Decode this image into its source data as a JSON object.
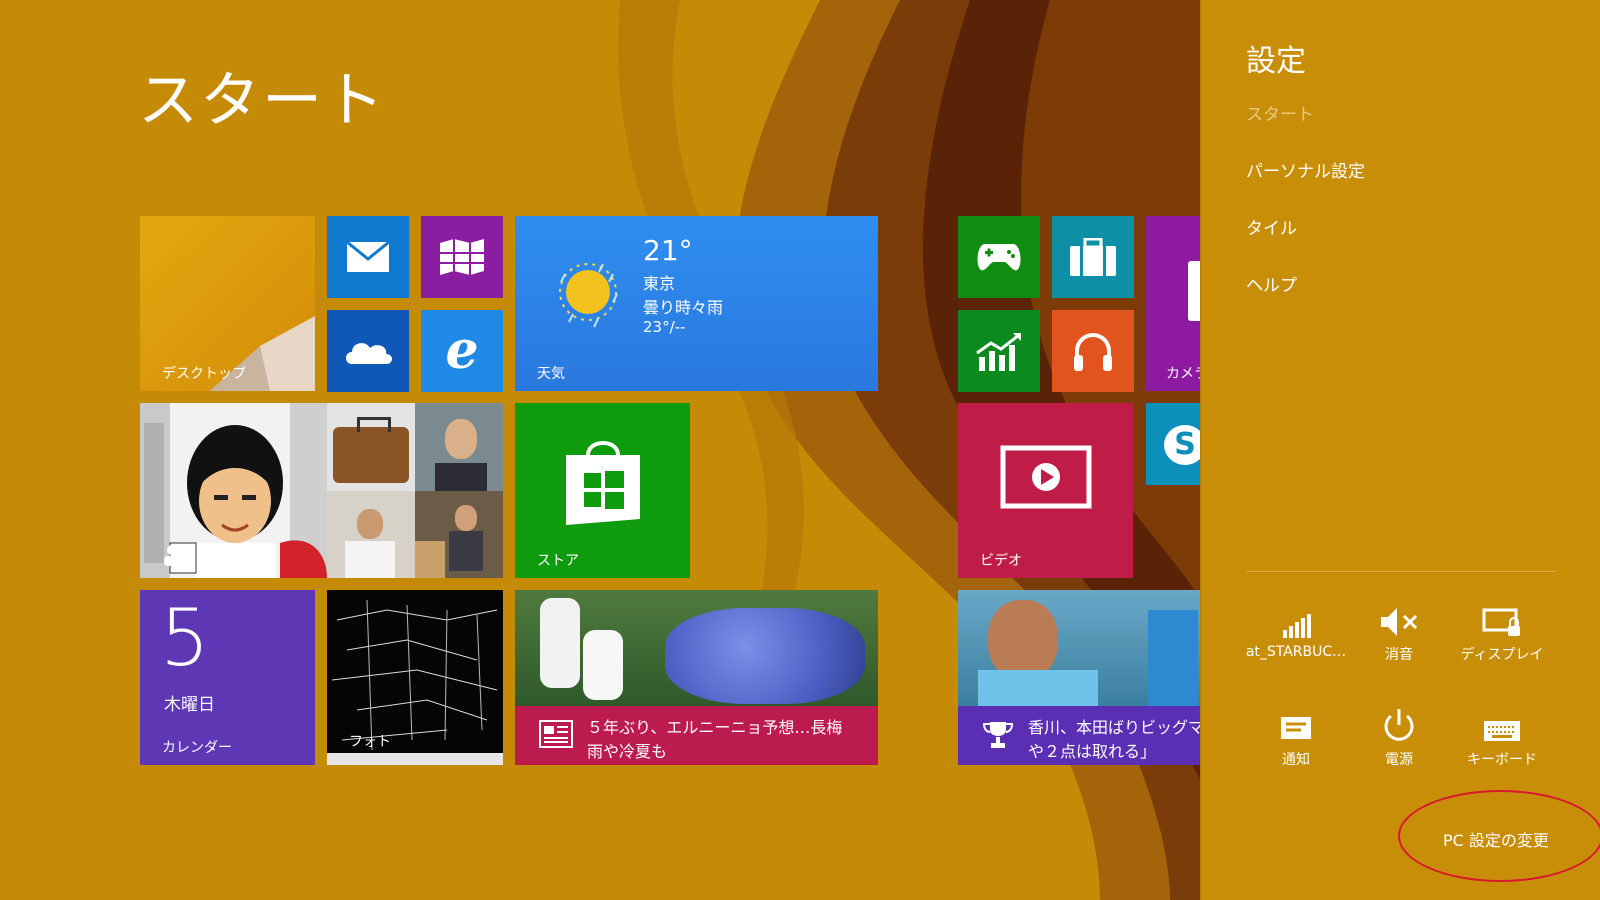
{
  "start": {
    "title": "スタート"
  },
  "tiles": {
    "desktop": "デスクトップ",
    "weather": {
      "label": "天気",
      "temp": "21°",
      "city": "東京",
      "condition": "曇り時々雨",
      "range": "23°/--"
    },
    "store": "ストア",
    "video": "ビデオ",
    "camera": "カメラ",
    "calendar": {
      "day": "5",
      "weekday": "木曜日",
      "label": "カレンダー"
    },
    "photos": "フォト",
    "news": {
      "headline_line1": "５年ぶり、エルニーニョ予想…長梅",
      "headline_line2": "雨や冷夏も"
    },
    "sports": {
      "headline_line1": "香川、本田ばりビッグマウス",
      "headline_line2": "や２点は取れる」"
    }
  },
  "charm": {
    "title": "設定",
    "links": [
      "スタート",
      "パーソナル設定",
      "タイル",
      "ヘルプ"
    ],
    "quick": [
      {
        "label": "at_STARBUC…",
        "icon": "wifi-signal-icon"
      },
      {
        "label": "消音",
        "icon": "mute-icon"
      },
      {
        "label": "ディスプレイ",
        "icon": "display-icon"
      },
      {
        "label": "通知",
        "icon": "notifications-icon"
      },
      {
        "label": "電源",
        "icon": "power-icon"
      },
      {
        "label": "キーボード",
        "icon": "keyboard-icon"
      }
    ],
    "pc_settings": "PC 設定の変更"
  },
  "colors": {
    "background": "#c58a06",
    "accent_green": "#0e9c0e",
    "accent_blue": "#2b80e8",
    "accent_purple": "#5e3ab5",
    "accent_crimson": "#c1174f",
    "annotation_red": "#d8182c"
  }
}
